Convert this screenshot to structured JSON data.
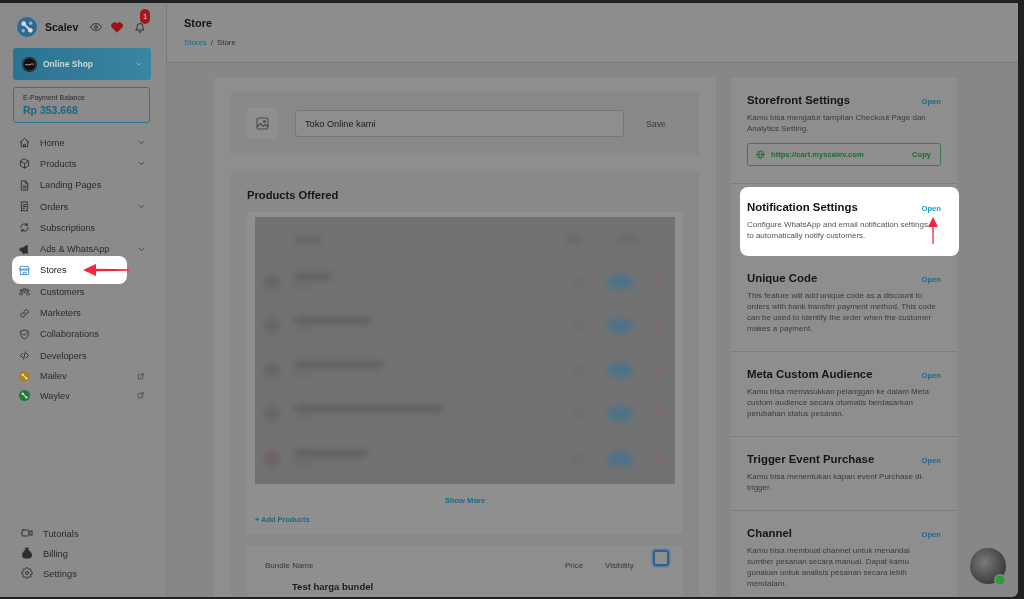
{
  "sidebar": {
    "brand": "Scalev",
    "notification_count": "1",
    "shop": {
      "name": "Online Shop"
    },
    "balance": {
      "label": "E-Payment Balance",
      "value": "Rp 353.668"
    },
    "nav": [
      {
        "label": "Home",
        "kind": "page",
        "has_submenu": true,
        "spotlight": false
      },
      {
        "label": "Products",
        "kind": "page",
        "has_submenu": true,
        "spotlight": false
      },
      {
        "label": "Landing Pages",
        "kind": "page",
        "has_submenu": false,
        "spotlight": false
      },
      {
        "label": "Orders",
        "kind": "page",
        "has_submenu": true,
        "spotlight": false
      },
      {
        "label": "Subscriptions",
        "kind": "page",
        "has_submenu": false,
        "spotlight": false
      },
      {
        "label": "Ads & WhatsApp",
        "kind": "page",
        "has_submenu": true,
        "spotlight": false
      },
      {
        "label": "Stores",
        "kind": "page",
        "has_submenu": false,
        "spotlight": true
      },
      {
        "label": "Customers",
        "kind": "page",
        "has_submenu": false,
        "spotlight": false
      },
      {
        "label": "Marketers",
        "kind": "page",
        "has_submenu": false,
        "spotlight": false
      },
      {
        "label": "Collaborations",
        "kind": "page",
        "has_submenu": false,
        "spotlight": false
      },
      {
        "label": "Developers",
        "kind": "page",
        "has_submenu": false,
        "spotlight": false
      },
      {
        "label": "Mailev",
        "kind": "app",
        "has_submenu": false,
        "spotlight": false,
        "color": "#a9831c"
      },
      {
        "label": "Waylev",
        "kind": "app",
        "has_submenu": false,
        "spotlight": false,
        "color": "#1f7a3a"
      }
    ],
    "footer": [
      {
        "label": "Tutorials"
      },
      {
        "label": "Billing"
      },
      {
        "label": "Settings"
      }
    ]
  },
  "header": {
    "title": "Store",
    "breadcrumb": [
      {
        "label": "Stores",
        "kind": "link"
      },
      {
        "label": "Store",
        "kind": "current"
      }
    ],
    "separator": "/"
  },
  "store_form": {
    "name_value": "Toko Online kami",
    "save_label": "Save"
  },
  "products": {
    "title": "Products Offered",
    "show_more": "Show More",
    "add_label": "+ Add Products"
  },
  "bundles": {
    "columns": [
      "Bundle Name",
      "Price",
      "Visibility"
    ],
    "select_all": {
      "checked": false
    },
    "rows": [
      {
        "name": "Test harga bundel"
      }
    ]
  },
  "settings_cards": [
    {
      "title": "Storefront Settings",
      "action": "Open",
      "description": "Kamu bisa mengatur tampilan Checkout Page dan Analytics Setting.",
      "url": "https://cart.myscalev.com",
      "url_action": "Copy",
      "spotlight": false
    },
    {
      "title": "Notification Settings",
      "action": "Open",
      "description": "Configure WhatsApp and email notification settings to automatically notify customers.",
      "spotlight": true
    },
    {
      "title": "Unique Code",
      "action": "Open",
      "description": "This feature will add unique code as a discount to orders with bank transfer payment method. This code can be used to identify the order when the customer makes a payment.",
      "spotlight": false
    },
    {
      "title": "Meta Custom Audience",
      "action": "Open",
      "description": "Kamu bisa memasukkan pelanggan ke dalam Meta custom audience secara otomatis berdasarkan perubahan status pesanan.",
      "spotlight": false
    },
    {
      "title": "Trigger Event Purchase",
      "action": "Open",
      "description": "Kamu bisa menentukan kapan event Purchase di-trigger.",
      "spotlight": false
    },
    {
      "title": "Channel",
      "action": "Open",
      "description": "Kamu bisa membuat channel untuk menandai sumber pesanan secara manual. Dapat kamu gunakan untuk analisis pesanan secara lebih mendalam.",
      "spotlight": false
    }
  ],
  "chat_avatar": {
    "online": true
  }
}
